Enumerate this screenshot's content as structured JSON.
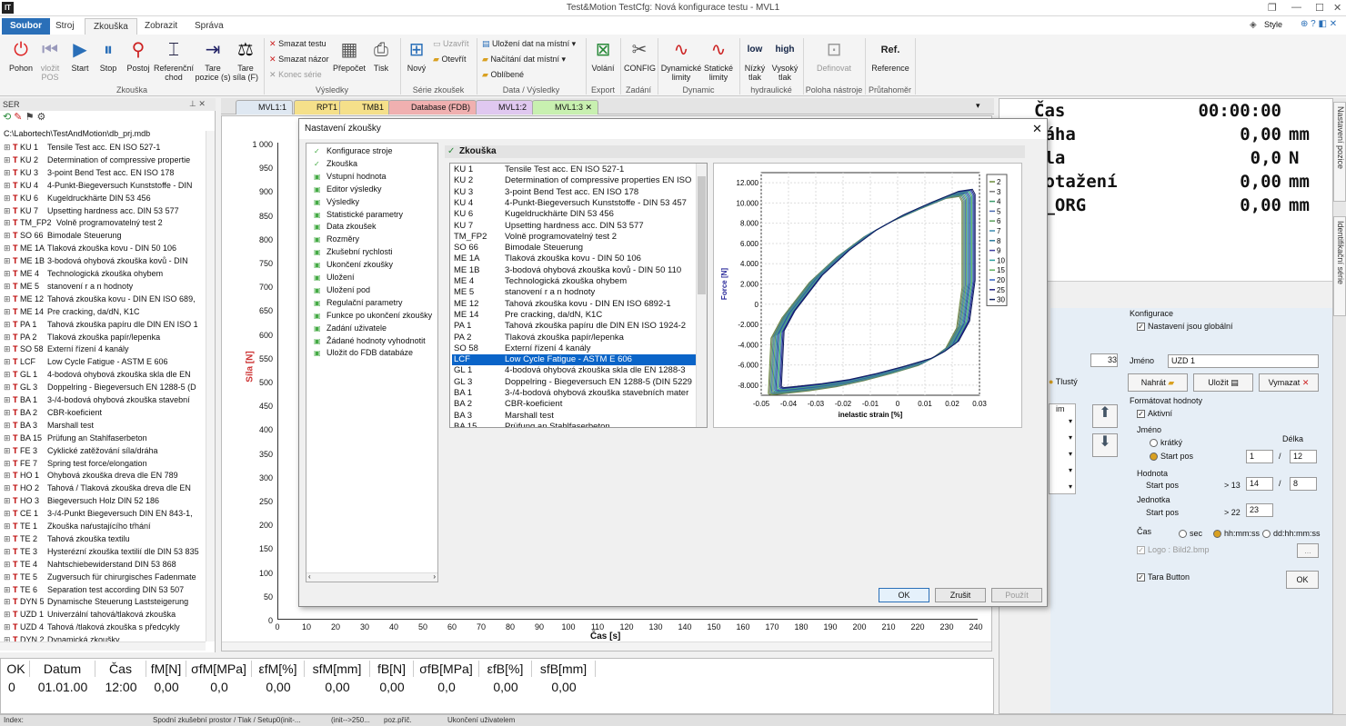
{
  "window": {
    "title": "Test&Motion  TestCfg: Nová konfigurace testu -  MVL1",
    "logo": "IT",
    "style_label": "Style"
  },
  "menu": {
    "tabs": [
      "Soubor",
      "Stroj",
      "Zkouška",
      "Zobrazit",
      "Správa"
    ],
    "active": "Zkouška"
  },
  "ribbon": {
    "zkouska": {
      "group": "Zkouška",
      "buttons": [
        "Pohon",
        "vložit POS",
        "Start",
        "Stop",
        "Postoj",
        "Referenční chod",
        "Tare pozice (s)",
        "Tare síla (F)"
      ]
    },
    "vysledky": {
      "group": "Výsledky",
      "small": [
        "Smazat testu",
        "Smazat názor",
        "Konec série"
      ],
      "buttons": [
        "Přepočet",
        "Tisk"
      ]
    },
    "serie": {
      "group": "Série zkoušek",
      "buttons": [
        "Nový"
      ],
      "small": [
        "Uzavřít",
        "Otevřít"
      ]
    },
    "data": {
      "group": "Data / Výsledky",
      "small": [
        "Uložení dat na místní",
        "Načítání dat místní",
        "Oblíbené"
      ]
    },
    "export": {
      "group": "Export",
      "buttons": [
        "Volání"
      ]
    },
    "zadani": {
      "group": "Zadání",
      "buttons": [
        "CONFIG"
      ]
    },
    "dynamic": {
      "group": "Dynamic",
      "buttons": [
        "Dynamické limity",
        "Statické limity"
      ]
    },
    "hydraulicke": {
      "group": "hydraulické",
      "buttons": [
        "Nízký tlak",
        "Vysoký tlak"
      ],
      "icons": [
        "low",
        "high"
      ]
    },
    "poloha": {
      "group": "Poloha nástroje",
      "buttons": [
        "Definovat"
      ]
    },
    "prutahomer": {
      "group": "Průtahoměr",
      "buttons": [
        "Reference"
      ]
    }
  },
  "left_panel": {
    "header": "SER",
    "path": "C:\\Labortech\\TestAndMotion\\db_prj.mdb",
    "items": [
      {
        "code": "KU 1",
        "name": "Tensile Test acc. EN ISO 527-1"
      },
      {
        "code": "KU 2",
        "name": "Determination of compressive propertie"
      },
      {
        "code": "KU 3",
        "name": "3-point Bend Test acc. EN ISO 178"
      },
      {
        "code": "KU 4",
        "name": "4-Punkt-Biegeversuch Kunststoffe - DIN"
      },
      {
        "code": "KU 6",
        "name": "Kugeldruckhärte DIN 53 456"
      },
      {
        "code": "KU 7",
        "name": "Upsetting hardness acc. DIN 53 577"
      },
      {
        "code": "TM_FP2",
        "name": "Volně programovatelný test 2"
      },
      {
        "code": "SO 66",
        "name": "Bimodale Steuerung"
      },
      {
        "code": "ME 1A",
        "name": "Tlaková zkouška kovu - DIN 50 106"
      },
      {
        "code": "ME 1B",
        "name": "3-bodová ohybová zkouška kovů - DIN"
      },
      {
        "code": "ME 4",
        "name": "Technologická zkouška ohybem"
      },
      {
        "code": "ME 5",
        "name": "stanovení r a n hodnoty"
      },
      {
        "code": "ME 12",
        "name": "Tahová zkouška kovu - DIN EN ISO 689,"
      },
      {
        "code": "ME 14",
        "name": "Pre cracking, da/dN, K1C"
      },
      {
        "code": "PA 1",
        "name": "Tahová zkouška papíru dle DIN EN ISO 1"
      },
      {
        "code": "PA 2",
        "name": "Tlaková zkouška papír/lepenka"
      },
      {
        "code": "SO 58",
        "name": "Externí řízení 4 kanály"
      },
      {
        "code": "LCF",
        "name": "Low Cycle Fatigue - ASTM E 606"
      },
      {
        "code": "GL 1",
        "name": "4-bodová ohybová zkouška skla dle  EN"
      },
      {
        "code": "GL 3",
        "name": "Doppelring - Biegeversuch EN 1288-5 (D"
      },
      {
        "code": "BA 1",
        "name": "3-/4-bodová ohybová zkouška stavební"
      },
      {
        "code": "BA 2",
        "name": "CBR-koeficient"
      },
      {
        "code": "BA 3",
        "name": "Marshall test"
      },
      {
        "code": "BA 15",
        "name": "Prüfung an Stahlfaserbeton"
      },
      {
        "code": "FE 3",
        "name": "Cyklické zatěžování síla/dráha"
      },
      {
        "code": "FE 7",
        "name": "Spring test force/elongation"
      },
      {
        "code": "HO 1",
        "name": "Ohybová zkouška dreva dle EN 789"
      },
      {
        "code": "HO 2",
        "name": "Tahová / Tlaková zkouška dreva dle EN"
      },
      {
        "code": "HO 3",
        "name": "Biegeversuch Holz  DIN 52 186"
      },
      {
        "code": "CE 1",
        "name": "3-/4-Punkt Biegeversuch DIN EN 843-1,"
      },
      {
        "code": "TE 1",
        "name": "Zkouška naŕustajícího tŕhání"
      },
      {
        "code": "TE 2",
        "name": "Tahová zkouška textilu"
      },
      {
        "code": "TE 3",
        "name": "Hysterézní zkouška textilií dle DIN 53 835"
      },
      {
        "code": "TE 4",
        "name": "Nahtschiebewiderstand DIN 53 868"
      },
      {
        "code": "TE 5",
        "name": "Zugversuch für chirurgisches Fadenmate"
      },
      {
        "code": "TE 6",
        "name": "Separation test according DIN 53 507"
      },
      {
        "code": "DYN 5",
        "name": "Dynamische Steuerung Laststeigerung"
      },
      {
        "code": "UZD 1",
        "name": "Univerzální tahová/tlaková zkouška"
      },
      {
        "code": "UZD 4",
        "name": "Tahová /tlaková zkouška s předcykly"
      },
      {
        "code": "DYN 2",
        "name": "Dynamická zkoušky"
      }
    ]
  },
  "doc_tabs": [
    "MVL1:1",
    "RPT1",
    "TMB1",
    "Database (FDB)",
    "MVL1:2",
    "MVL1:3"
  ],
  "plot": {
    "ylabel": "Síla [N]",
    "xlabel": "Čas [s]",
    "yticks": [
      "1 000",
      "950",
      "900",
      "850",
      "800",
      "750",
      "700",
      "650",
      "600",
      "550",
      "500",
      "450",
      "400",
      "350",
      "300",
      "250",
      "200",
      "150",
      "100",
      "50",
      "0"
    ],
    "xticks": [
      "0",
      "10",
      "20",
      "30",
      "40",
      "50",
      "60",
      "70",
      "80",
      "90",
      "100",
      "110",
      "120",
      "130",
      "140",
      "150",
      "160",
      "170",
      "180",
      "190",
      "200",
      "210",
      "220",
      "230",
      "240"
    ]
  },
  "readout": [
    {
      "label": "Čas",
      "value": "00:00:00",
      "unit": ""
    },
    {
      "label": "ráha",
      "value": "0,00",
      "unit": "mm"
    },
    {
      "label": "íla",
      "value": "0,0",
      "unit": "N"
    },
    {
      "label": "rotažení",
      "value": "0,00",
      "unit": "mm"
    },
    {
      "label": "L_ORG",
      "value": "0,00",
      "unit": "mm"
    }
  ],
  "side_tabs": [
    "Nastavení pozice",
    "Identifikační série"
  ],
  "config": {
    "section": "Konfigurace",
    "global_label": "Nastavení jsou globální",
    "name_label": "Jméno",
    "name_value": "UZD 1",
    "load_btn": "Nahrát",
    "save_btn": "Uložit",
    "delete_btn": "Vymazat",
    "format_section": "Formátovat hodnoty",
    "active_label": "Aktivní",
    "jmeno_label": "Jméno",
    "delka_label": "Délka",
    "kratky_label": "krátký",
    "startpos_label": "Start pos",
    "hodnota_label": "Hodnota",
    "jednotka_label": "Jednotka",
    "cas_label": "Čas",
    "sec_label": "sec",
    "hhmmss_label": "hh:mm:ss",
    "ddhhmmss_label": "dd:hh:mm:ss",
    "logo_label": "Logo : Bild2.bmp",
    "tara_label": "Tara Button",
    "ok_btn": "OK",
    "v1": "1",
    "v2": "12",
    "v3": "14",
    "v4": "8",
    "v5": "23",
    "gt13": "> 13",
    "gt22": "> 22",
    "left_num": "33",
    "tlusty": "Tlustý",
    "dots": "..."
  },
  "table": {
    "headers": [
      "OK",
      "Datum",
      "Čas",
      "fM[N]",
      "σfM[MPa]",
      "εfM[%]",
      "sfM[mm]",
      "fB[N]",
      "σfB[MPa]",
      "εfB[%]",
      "sfB[mm]"
    ],
    "row": [
      "0",
      "01.01.00",
      "12:00",
      "0,00",
      "0,0",
      "0,00",
      "0,00",
      "0,00",
      "0,0",
      "0,00",
      "0,00"
    ]
  },
  "status": {
    "index": "Index:",
    "s1": "Spodní zkušební prostor / Tlak / Setup0(init-...",
    "s2": "(init-->250...",
    "s3": "poz.příč.",
    "s4": "Ukončení uživatelem"
  },
  "dialog": {
    "title": "Nastavení zkoušky",
    "header": "Zkouška",
    "nav": [
      "Konfigurace stroje",
      "Zkouška",
      "Vstupní hodnota",
      "Editor výsledky",
      "Výsledky",
      "Statistické parametry",
      "Data zkoušek",
      "Rozměry",
      "Zkušební rychlosti",
      "Ukončení zkoušky",
      "Uložení",
      "Uložení pod",
      "Regulační parametry",
      "Funkce po ukončení zkoušky",
      "Zadání uživatele",
      "Žádané hodnoty vyhodnotit",
      "Uložit do FDB databáze"
    ],
    "list": [
      {
        "code": "KU 1",
        "name": "Tensile Test acc. EN ISO 527-1"
      },
      {
        "code": "KU 2",
        "name": "Determination of compressive properties EN ISO"
      },
      {
        "code": "KU 3",
        "name": "3-point Bend Test acc. EN ISO 178"
      },
      {
        "code": "KU 4",
        "name": "4-Punkt-Biegeversuch Kunststoffe - DIN 53 457"
      },
      {
        "code": "KU 6",
        "name": "Kugeldruckhärte DIN 53 456"
      },
      {
        "code": "KU 7",
        "name": "Upsetting hardness acc. DIN 53 577"
      },
      {
        "code": "TM_FP2",
        "name": "Volně programovatelný test 2"
      },
      {
        "code": "SO 66",
        "name": "Bimodale Steuerung"
      },
      {
        "code": "ME 1A",
        "name": "Tlaková zkouška kovu - DIN 50 106"
      },
      {
        "code": "ME 1B",
        "name": "3-bodová ohybová zkouška kovů - DIN 50 110"
      },
      {
        "code": "ME 4",
        "name": "Technologická zkouška ohybem"
      },
      {
        "code": "ME 5",
        "name": "stanovení r a n hodnoty"
      },
      {
        "code": "ME 12",
        "name": "Tahová zkouška kovu - DIN EN ISO 6892-1"
      },
      {
        "code": "ME 14",
        "name": "Pre cracking, da/dN, K1C"
      },
      {
        "code": "PA 1",
        "name": "Tahová zkouška papíru dle DIN EN ISO 1924-2"
      },
      {
        "code": "PA 2",
        "name": "Tlaková zkouška papír/lepenka"
      },
      {
        "code": "SO 58",
        "name": "Externí řízení 4 kanály"
      },
      {
        "code": "LCF",
        "name": "Low Cycle Fatigue - ASTM E 606"
      },
      {
        "code": "GL 1",
        "name": "4-bodová ohybová zkouška skla dle  EN 1288-3"
      },
      {
        "code": "GL 3",
        "name": "Doppelring - Biegeversuch EN 1288-5 (DIN 5229"
      },
      {
        "code": "BA 1",
        "name": "3-/4-bodová ohybová zkouška stavebních mater"
      },
      {
        "code": "BA 2",
        "name": "CBR-koeficient"
      },
      {
        "code": "BA 3",
        "name": "Marshall test"
      },
      {
        "code": "BA 15",
        "name": "Prüfung an Stahlfaserbeton"
      }
    ],
    "selected": "LCF",
    "ok": "OK",
    "cancel": "Zrušit",
    "apply": "Použít"
  },
  "chart_data": {
    "type": "line",
    "title": "",
    "xlabel": "inelastic strain [%]",
    "ylabel": "Force [N]",
    "xlim": [
      -0.05,
      0.03
    ],
    "ylim": [
      -9000,
      13000
    ],
    "xticks": [
      -0.05,
      -0.04,
      -0.03,
      -0.02,
      -0.01,
      0,
      0.01,
      0.02,
      0.03
    ],
    "yticks": [
      -8000,
      -6000,
      -4000,
      -2000,
      0,
      2000,
      4000,
      6000,
      8000,
      10000,
      12000
    ],
    "xtick_labels": [
      "-0.05",
      "-0.04",
      "-0.03",
      "-0.02",
      "-0.01",
      "0",
      "0.01",
      "0.02",
      "0.03"
    ],
    "ytick_labels": [
      "-8.000",
      "-6.000",
      "-4.000",
      "-2.000",
      "0",
      "2.000",
      "4.000",
      "6.000",
      "8.000",
      "10.000",
      "12.000"
    ],
    "legend_position": "right",
    "grid": true,
    "series": [
      {
        "name": "2",
        "color": "#6a8a3a"
      },
      {
        "name": "3",
        "color": "#7a7a7a"
      },
      {
        "name": "4",
        "color": "#3a9a6a"
      },
      {
        "name": "5",
        "color": "#4a6ab0"
      },
      {
        "name": "6",
        "color": "#5aa05a"
      },
      {
        "name": "7",
        "color": "#3a8ab0"
      },
      {
        "name": "8",
        "color": "#2a7a9a"
      },
      {
        "name": "9",
        "color": "#4040a0"
      },
      {
        "name": "10",
        "color": "#30a0a0"
      },
      {
        "name": "15",
        "color": "#60b060"
      },
      {
        "name": "20",
        "color": "#3060c0"
      },
      {
        "name": "25",
        "color": "#202080"
      },
      {
        "name": "30",
        "color": "#102060"
      }
    ],
    "loop": {
      "x": [
        -0.045,
        -0.044,
        -0.04,
        -0.03,
        -0.02,
        -0.01,
        0,
        0.01,
        0.02,
        0.025,
        0.026,
        0.026,
        0.024,
        0.02,
        0.015,
        0.01,
        0,
        -0.01,
        -0.02,
        -0.03,
        -0.04,
        -0.044,
        -0.045
      ],
      "y": [
        -8500,
        -3000,
        -1000,
        2500,
        5000,
        7000,
        8500,
        9700,
        10800,
        11000,
        10500,
        2000,
        -2000,
        -4000,
        -5000,
        -5700,
        -6500,
        -7200,
        -7800,
        -8200,
        -8500,
        -8600,
        -8500
      ]
    }
  },
  "colors": {
    "accent": "#2a6fb8",
    "selection": "#0a64c8",
    "tree_marker": "#b00000",
    "grid": "#dddddd"
  }
}
